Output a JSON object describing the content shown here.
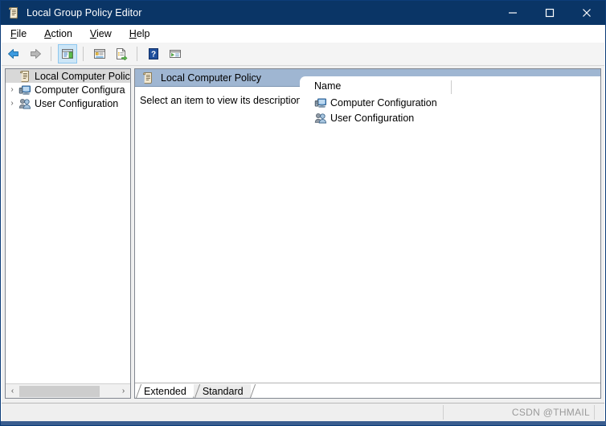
{
  "window": {
    "title": "Local Group Policy Editor",
    "icon": "policy-scroll-icon",
    "controls": {
      "minimize": "minimize-icon",
      "maximize": "maximize-icon",
      "close": "close-icon"
    },
    "accent_titlebar": "#0a3566"
  },
  "menubar": {
    "items": [
      {
        "pre": "",
        "accel": "F",
        "post": "ile",
        "name": "file"
      },
      {
        "pre": "",
        "accel": "A",
        "post": "ction",
        "name": "action"
      },
      {
        "pre": "",
        "accel": "V",
        "post": "iew",
        "name": "view"
      },
      {
        "pre": "",
        "accel": "H",
        "post": "elp",
        "name": "help"
      }
    ]
  },
  "toolbar": {
    "buttons": [
      {
        "name": "back-button",
        "icon": "back-arrow-icon",
        "enabled": true,
        "selected": false
      },
      {
        "name": "forward-button",
        "icon": "forward-arrow-icon",
        "enabled": false,
        "selected": false
      },
      {
        "name": "show-hide-console-tree-button",
        "icon": "console-tree-icon",
        "enabled": true,
        "selected": true
      },
      {
        "name": "properties-button",
        "icon": "properties-icon",
        "enabled": true,
        "selected": false
      },
      {
        "name": "export-list-button",
        "icon": "export-list-icon",
        "enabled": true,
        "selected": false
      },
      {
        "name": "help-button",
        "icon": "help-question-icon",
        "enabled": true,
        "selected": false
      },
      {
        "name": "show-action-pane-button",
        "icon": "action-pane-icon",
        "enabled": true,
        "selected": false
      }
    ]
  },
  "tree": {
    "items": [
      {
        "label": "Local Computer Policy",
        "icon": "policy-scroll-icon",
        "expander": "",
        "selected": true,
        "name": "sidebar-item-local-computer-policy"
      },
      {
        "label": "Computer Configura",
        "icon": "computer-monitor-icon",
        "expander": "›",
        "selected": false,
        "name": "sidebar-item-computer-configuration"
      },
      {
        "label": "User Configuration",
        "icon": "user-people-icon",
        "expander": "›",
        "selected": false,
        "name": "sidebar-item-user-configuration"
      }
    ],
    "scrollbar": {
      "left_arrow": "‹",
      "right_arrow": "›"
    }
  },
  "right_pane": {
    "header_title": "Local Computer Policy",
    "header_icon": "policy-scroll-icon",
    "description": "Select an item to view its description.",
    "list": {
      "columns": [
        "Name"
      ],
      "rows": [
        {
          "name_value": "Computer Configuration",
          "icon": "computer-monitor-icon"
        },
        {
          "name_value": "User Configuration",
          "icon": "user-people-icon"
        }
      ]
    },
    "tabs": [
      {
        "label": "Extended",
        "active": false,
        "name": "tab-extended"
      },
      {
        "label": "Standard",
        "active": true,
        "name": "tab-standard"
      }
    ]
  },
  "statusbar": {
    "watermark": "CSDN @THMAIL"
  }
}
